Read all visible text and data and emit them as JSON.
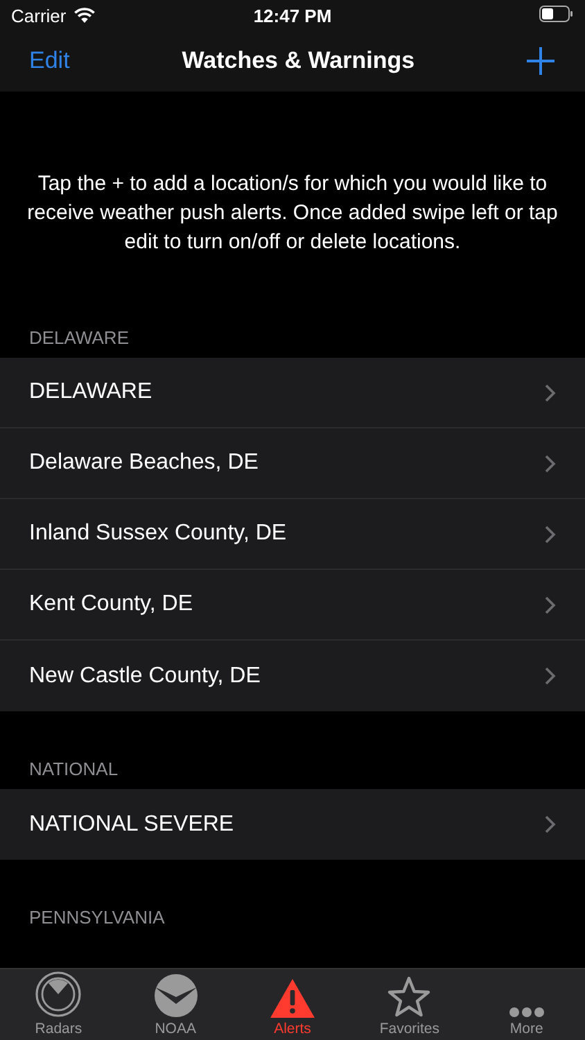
{
  "status_bar": {
    "carrier": "Carrier",
    "time": "12:47 PM"
  },
  "nav": {
    "left": "Edit",
    "title": "Watches & Warnings"
  },
  "intro": "Tap the + to add a location/s for which you would like to receive weather push alerts. Once added swipe left or tap edit to turn on/off or delete locations.",
  "sections": [
    {
      "header": "DELAWARE",
      "rows": [
        {
          "label": "DELAWARE"
        },
        {
          "label": "Delaware Beaches, DE"
        },
        {
          "label": "Inland Sussex County, DE"
        },
        {
          "label": "Kent County, DE"
        },
        {
          "label": "New Castle County, DE"
        }
      ]
    },
    {
      "header": "NATIONAL",
      "rows": [
        {
          "label": "NATIONAL SEVERE"
        }
      ]
    },
    {
      "header": "PENNSYLVANIA"
    }
  ],
  "tabs": [
    {
      "kind": "radar",
      "label": "Radars",
      "selected": false
    },
    {
      "kind": "noaa",
      "label": "NOAA",
      "selected": false
    },
    {
      "kind": "alert",
      "label": "Alerts",
      "selected": true
    },
    {
      "kind": "star",
      "label": "Favorites",
      "selected": false
    },
    {
      "kind": "more",
      "label": "More",
      "selected": false
    }
  ]
}
